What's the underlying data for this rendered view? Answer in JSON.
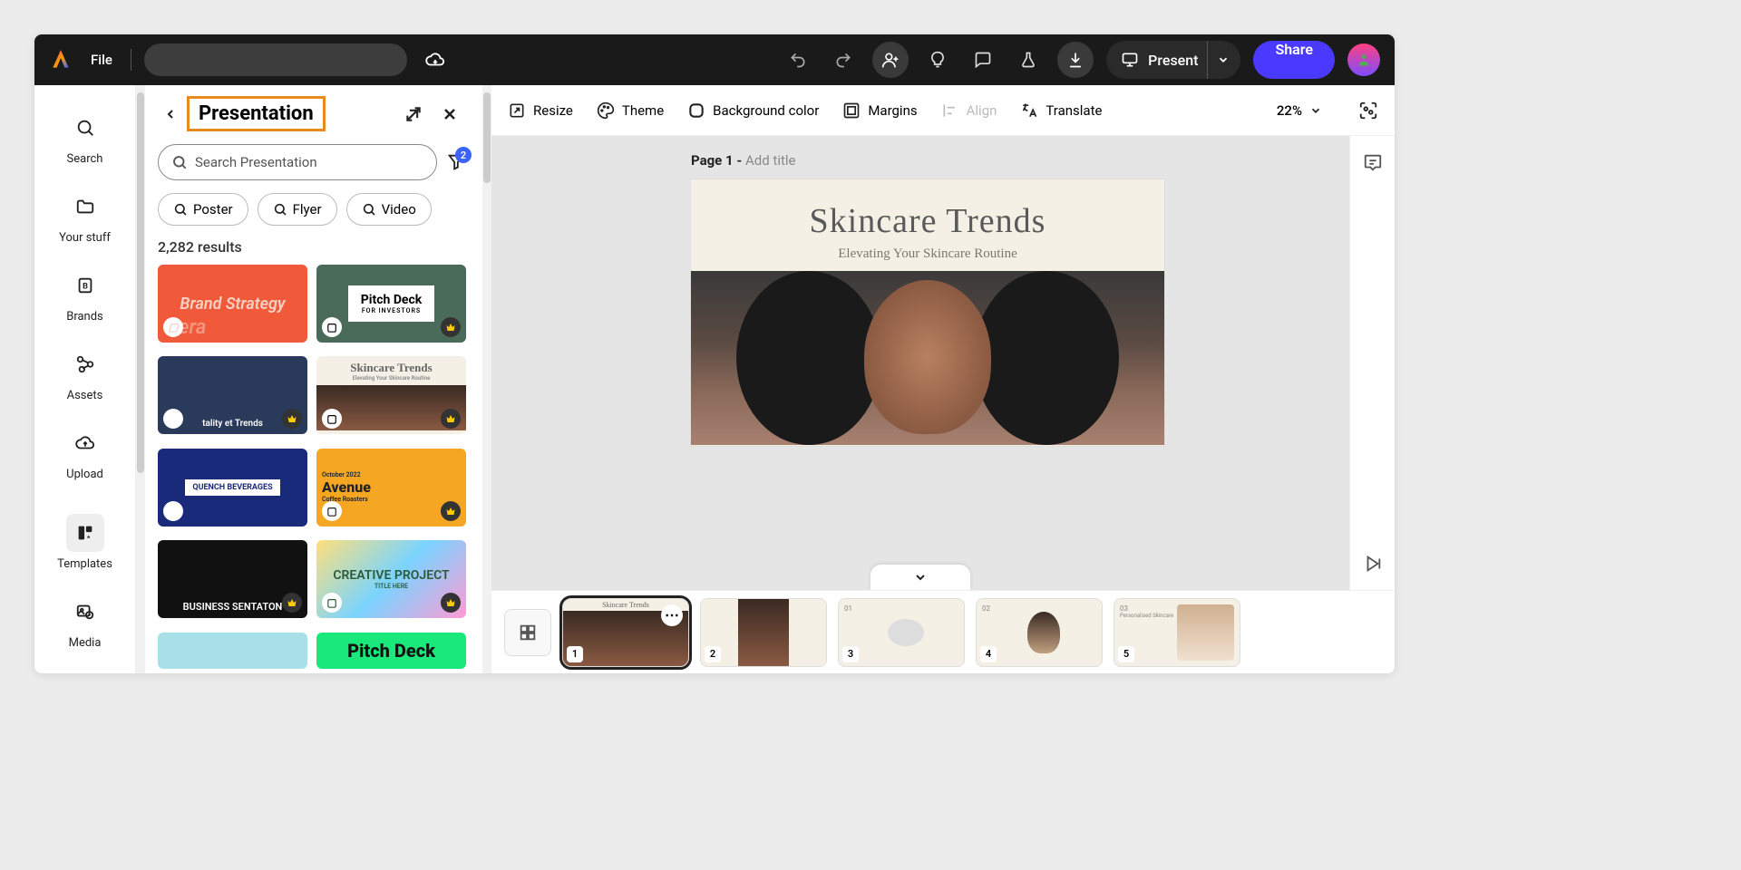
{
  "topbar": {
    "file_label": "File",
    "present_label": "Present",
    "share_label": "Share"
  },
  "leftrail": {
    "items": [
      {
        "label": "Search"
      },
      {
        "label": "Your stuff"
      },
      {
        "label": "Brands"
      },
      {
        "label": "Assets"
      },
      {
        "label": "Upload"
      },
      {
        "label": "Templates"
      },
      {
        "label": "Media"
      }
    ]
  },
  "panel": {
    "title": "Presentation",
    "search_placeholder": "Search Presentation",
    "filter_badge": "2",
    "pills": [
      {
        "label": "Poster"
      },
      {
        "label": "Flyer"
      },
      {
        "label": "Video"
      }
    ],
    "results_count": "2,282 results",
    "templates": [
      {
        "title": "Brand Strategy",
        "sub": "Sera"
      },
      {
        "title": "Pitch Deck",
        "sub": "FOR INVESTORS"
      },
      {
        "title": "tality et Trends",
        "sub": ""
      },
      {
        "title": "Skincare Trends",
        "sub": "Elevating Your Skincare Routine"
      },
      {
        "title": "QUENCH BEVERAGES",
        "sub": ""
      },
      {
        "title": "Avenue",
        "sub": "Coffee Roasters",
        "corner": "October 2022"
      },
      {
        "title": "BUSINESS SENTATON",
        "sub": ""
      },
      {
        "title": "CREATIVE PROJECT",
        "sub": "TITLE HERE"
      },
      {
        "title": "",
        "sub": ""
      },
      {
        "title": "Pitch Deck",
        "sub": ""
      }
    ]
  },
  "toolbar": {
    "resize": "Resize",
    "theme": "Theme",
    "bgcolor": "Background color",
    "margins": "Margins",
    "align": "Align",
    "translate": "Translate",
    "zoom": "22%"
  },
  "canvas": {
    "page_prefix": "Page 1 - ",
    "page_hint": "Add title",
    "slide_title": "Skincare Trends",
    "slide_subtitle": "Elevating Your Skincare Routine"
  },
  "thumbs": {
    "numbers": [
      "1",
      "2",
      "3",
      "4",
      "5"
    ],
    "headings": [
      "Skincare Trends",
      "",
      "01",
      "02",
      "03"
    ],
    "sub5": "Personalised Skincare"
  }
}
